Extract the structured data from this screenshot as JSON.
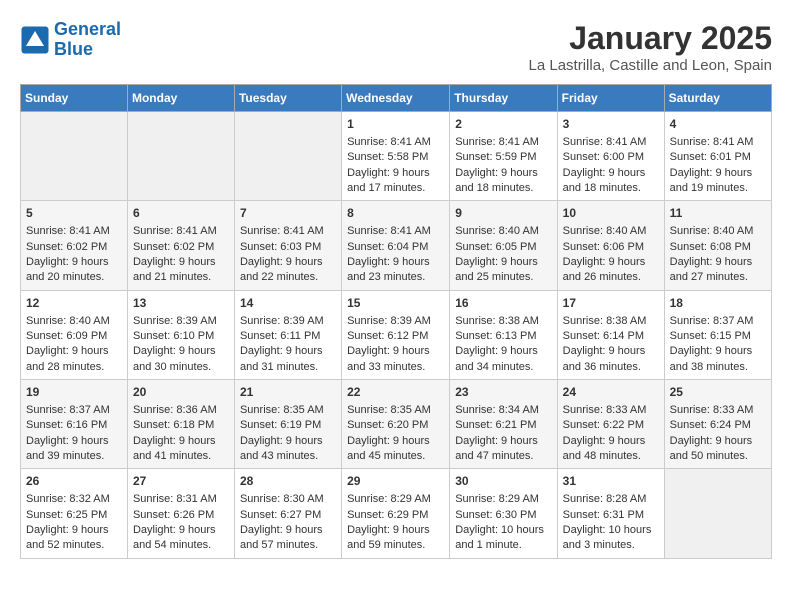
{
  "logo": {
    "line1": "General",
    "line2": "Blue"
  },
  "title": "January 2025",
  "subtitle": "La Lastrilla, Castille and Leon, Spain",
  "days_of_week": [
    "Sunday",
    "Monday",
    "Tuesday",
    "Wednesday",
    "Thursday",
    "Friday",
    "Saturday"
  ],
  "weeks": [
    [
      {
        "day": "",
        "info": ""
      },
      {
        "day": "",
        "info": ""
      },
      {
        "day": "",
        "info": ""
      },
      {
        "day": "1",
        "info": "Sunrise: 8:41 AM\nSunset: 5:58 PM\nDaylight: 9 hours\nand 17 minutes."
      },
      {
        "day": "2",
        "info": "Sunrise: 8:41 AM\nSunset: 5:59 PM\nDaylight: 9 hours\nand 18 minutes."
      },
      {
        "day": "3",
        "info": "Sunrise: 8:41 AM\nSunset: 6:00 PM\nDaylight: 9 hours\nand 18 minutes."
      },
      {
        "day": "4",
        "info": "Sunrise: 8:41 AM\nSunset: 6:01 PM\nDaylight: 9 hours\nand 19 minutes."
      }
    ],
    [
      {
        "day": "5",
        "info": "Sunrise: 8:41 AM\nSunset: 6:02 PM\nDaylight: 9 hours\nand 20 minutes."
      },
      {
        "day": "6",
        "info": "Sunrise: 8:41 AM\nSunset: 6:02 PM\nDaylight: 9 hours\nand 21 minutes."
      },
      {
        "day": "7",
        "info": "Sunrise: 8:41 AM\nSunset: 6:03 PM\nDaylight: 9 hours\nand 22 minutes."
      },
      {
        "day": "8",
        "info": "Sunrise: 8:41 AM\nSunset: 6:04 PM\nDaylight: 9 hours\nand 23 minutes."
      },
      {
        "day": "9",
        "info": "Sunrise: 8:40 AM\nSunset: 6:05 PM\nDaylight: 9 hours\nand 25 minutes."
      },
      {
        "day": "10",
        "info": "Sunrise: 8:40 AM\nSunset: 6:06 PM\nDaylight: 9 hours\nand 26 minutes."
      },
      {
        "day": "11",
        "info": "Sunrise: 8:40 AM\nSunset: 6:08 PM\nDaylight: 9 hours\nand 27 minutes."
      }
    ],
    [
      {
        "day": "12",
        "info": "Sunrise: 8:40 AM\nSunset: 6:09 PM\nDaylight: 9 hours\nand 28 minutes."
      },
      {
        "day": "13",
        "info": "Sunrise: 8:39 AM\nSunset: 6:10 PM\nDaylight: 9 hours\nand 30 minutes."
      },
      {
        "day": "14",
        "info": "Sunrise: 8:39 AM\nSunset: 6:11 PM\nDaylight: 9 hours\nand 31 minutes."
      },
      {
        "day": "15",
        "info": "Sunrise: 8:39 AM\nSunset: 6:12 PM\nDaylight: 9 hours\nand 33 minutes."
      },
      {
        "day": "16",
        "info": "Sunrise: 8:38 AM\nSunset: 6:13 PM\nDaylight: 9 hours\nand 34 minutes."
      },
      {
        "day": "17",
        "info": "Sunrise: 8:38 AM\nSunset: 6:14 PM\nDaylight: 9 hours\nand 36 minutes."
      },
      {
        "day": "18",
        "info": "Sunrise: 8:37 AM\nSunset: 6:15 PM\nDaylight: 9 hours\nand 38 minutes."
      }
    ],
    [
      {
        "day": "19",
        "info": "Sunrise: 8:37 AM\nSunset: 6:16 PM\nDaylight: 9 hours\nand 39 minutes."
      },
      {
        "day": "20",
        "info": "Sunrise: 8:36 AM\nSunset: 6:18 PM\nDaylight: 9 hours\nand 41 minutes."
      },
      {
        "day": "21",
        "info": "Sunrise: 8:35 AM\nSunset: 6:19 PM\nDaylight: 9 hours\nand 43 minutes."
      },
      {
        "day": "22",
        "info": "Sunrise: 8:35 AM\nSunset: 6:20 PM\nDaylight: 9 hours\nand 45 minutes."
      },
      {
        "day": "23",
        "info": "Sunrise: 8:34 AM\nSunset: 6:21 PM\nDaylight: 9 hours\nand 47 minutes."
      },
      {
        "day": "24",
        "info": "Sunrise: 8:33 AM\nSunset: 6:22 PM\nDaylight: 9 hours\nand 48 minutes."
      },
      {
        "day": "25",
        "info": "Sunrise: 8:33 AM\nSunset: 6:24 PM\nDaylight: 9 hours\nand 50 minutes."
      }
    ],
    [
      {
        "day": "26",
        "info": "Sunrise: 8:32 AM\nSunset: 6:25 PM\nDaylight: 9 hours\nand 52 minutes."
      },
      {
        "day": "27",
        "info": "Sunrise: 8:31 AM\nSunset: 6:26 PM\nDaylight: 9 hours\nand 54 minutes."
      },
      {
        "day": "28",
        "info": "Sunrise: 8:30 AM\nSunset: 6:27 PM\nDaylight: 9 hours\nand 57 minutes."
      },
      {
        "day": "29",
        "info": "Sunrise: 8:29 AM\nSunset: 6:29 PM\nDaylight: 9 hours\nand 59 minutes."
      },
      {
        "day": "30",
        "info": "Sunrise: 8:29 AM\nSunset: 6:30 PM\nDaylight: 10 hours\nand 1 minute."
      },
      {
        "day": "31",
        "info": "Sunrise: 8:28 AM\nSunset: 6:31 PM\nDaylight: 10 hours\nand 3 minutes."
      },
      {
        "day": "",
        "info": ""
      }
    ]
  ]
}
